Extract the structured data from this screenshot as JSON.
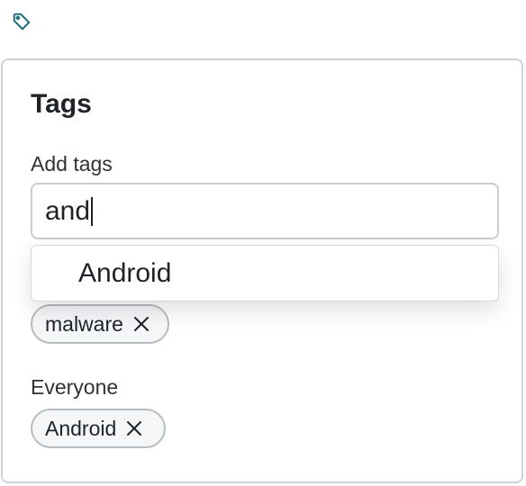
{
  "header": {
    "tag_icon": "tag-icon"
  },
  "panel": {
    "title": "Tags",
    "add_tags_label": "Add tags",
    "input_value": "and",
    "suggestions": [
      "Android"
    ],
    "applied_tags": [
      {
        "label": "malware",
        "remove_icon": "close-icon"
      }
    ],
    "everyone_label": "Everyone",
    "everyone_tags": [
      {
        "label": "Android",
        "remove_icon": "close-icon"
      }
    ]
  },
  "colors": {
    "icon": "#1d6f7a",
    "border": "#cfd3d7",
    "chip_border": "#b7bcc1",
    "text": "#1f2328"
  }
}
